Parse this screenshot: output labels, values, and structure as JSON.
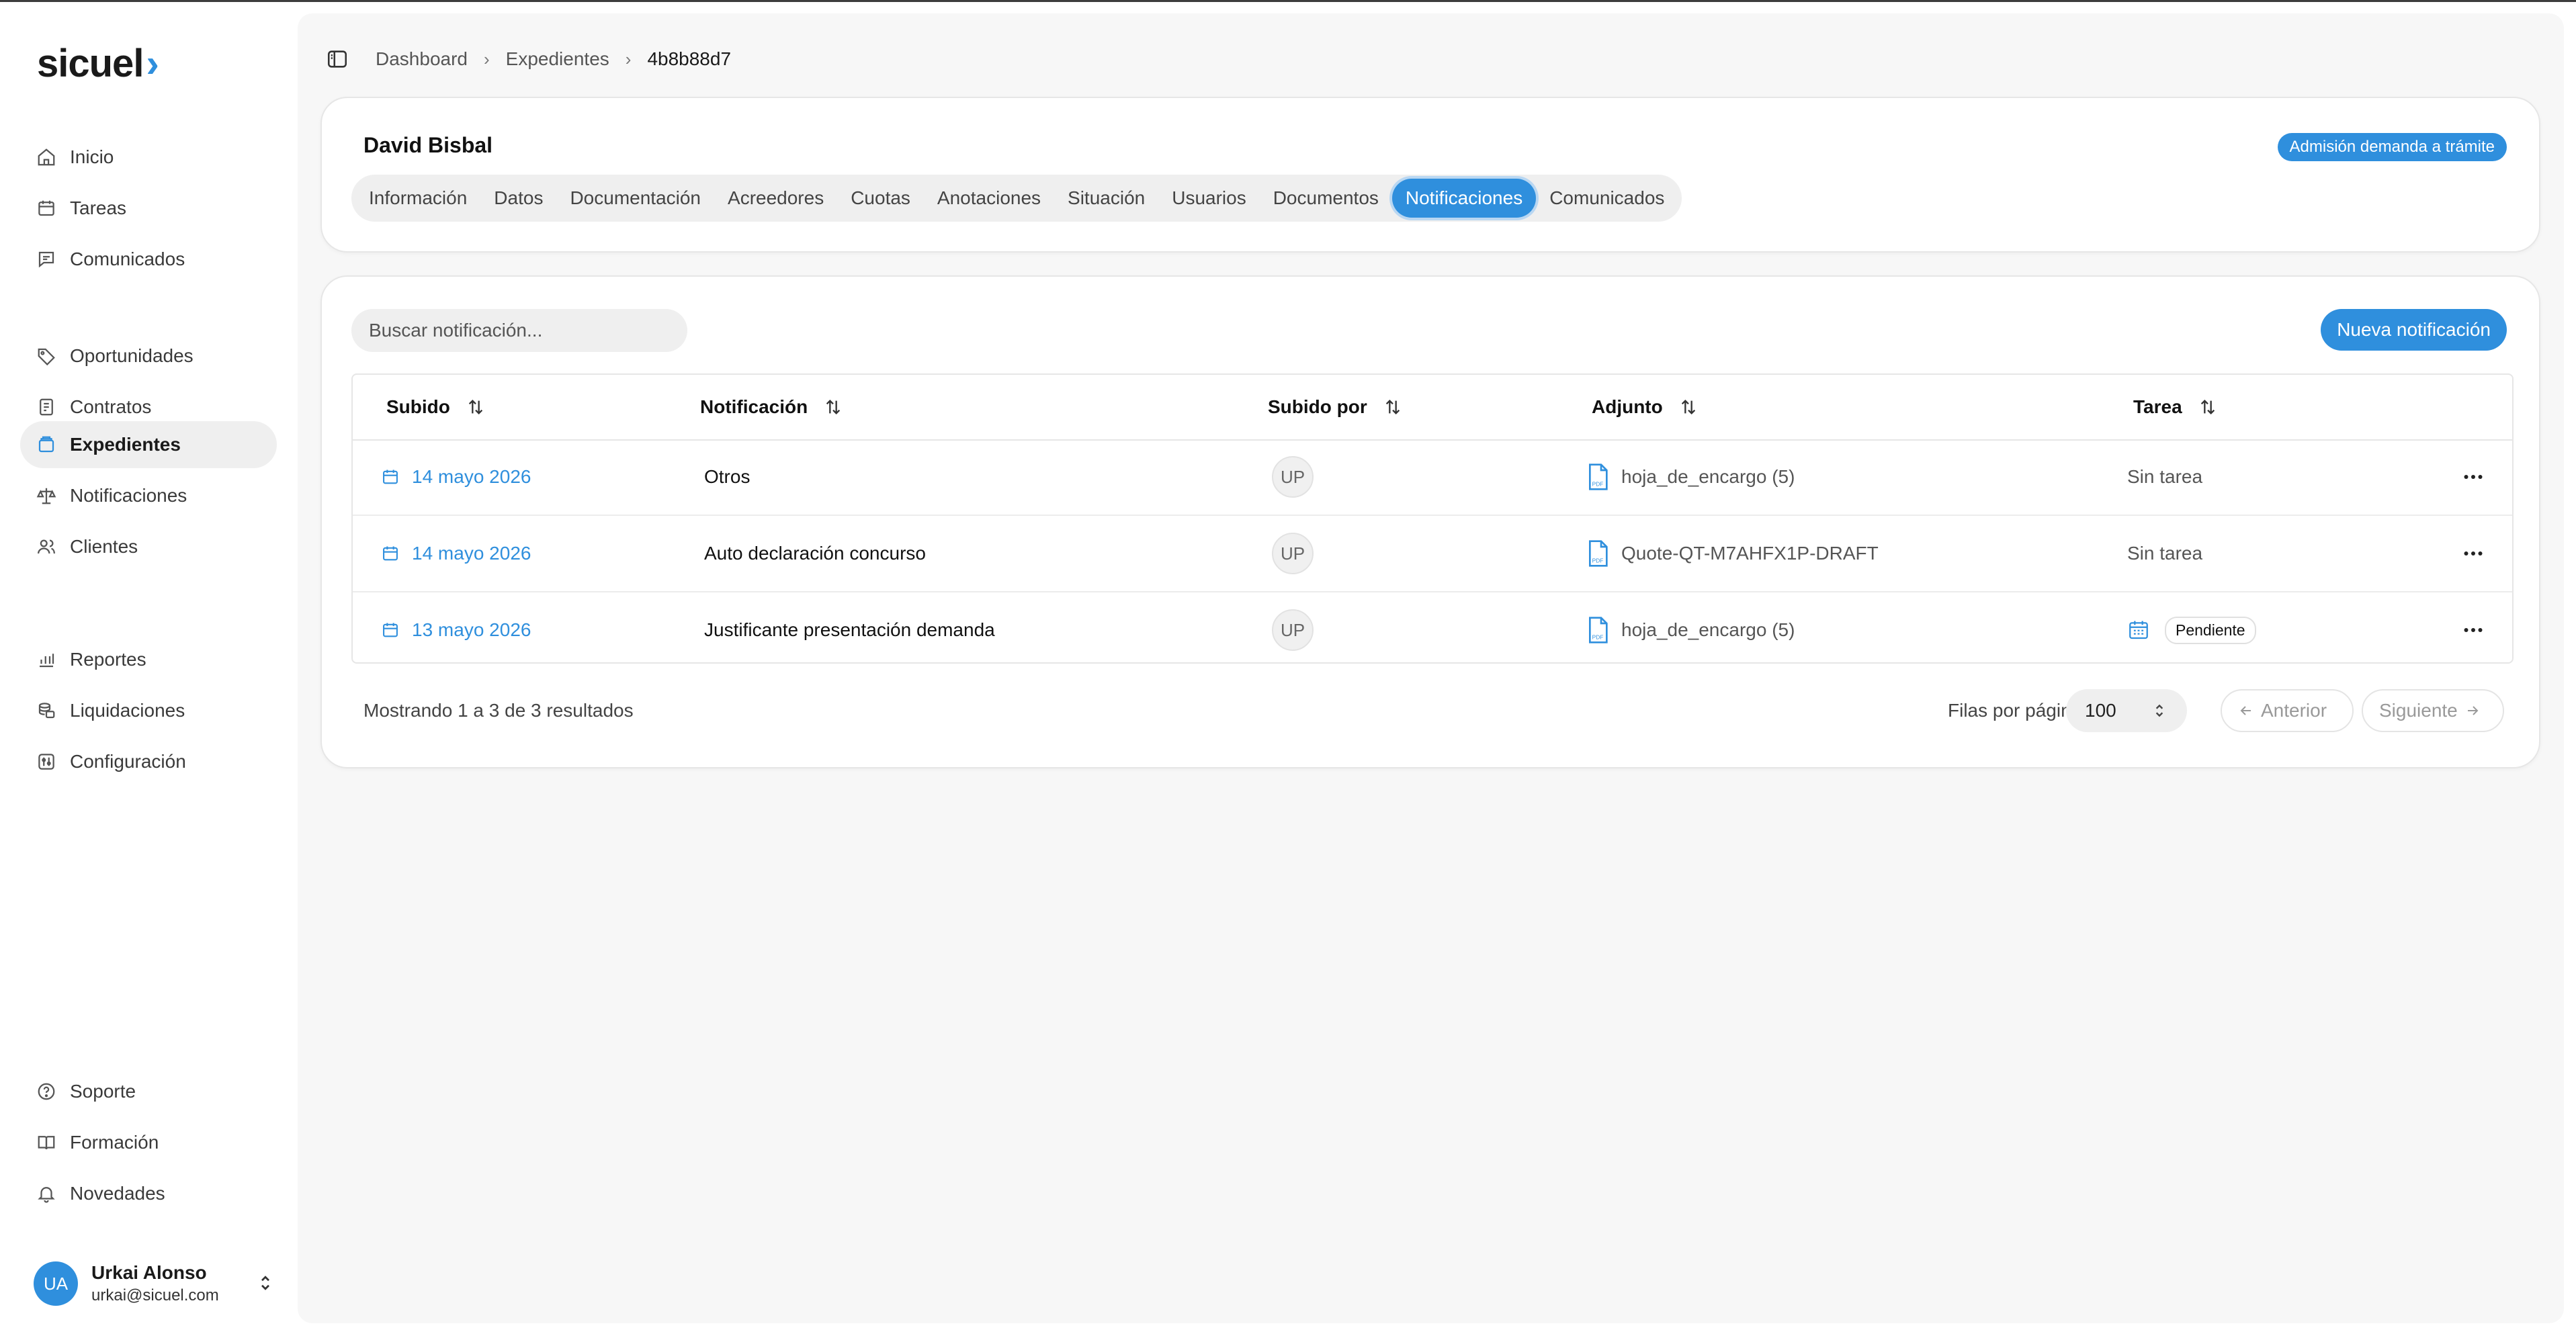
{
  "brand": {
    "name": "sicuel",
    "accent": "#2f8fdd"
  },
  "sidebar": {
    "items": [
      {
        "label": "Inicio",
        "icon": "home-icon"
      },
      {
        "label": "Tareas",
        "icon": "calendar-icon"
      },
      {
        "label": "Comunicados",
        "icon": "message-icon"
      },
      {
        "label": "Oportunidades",
        "icon": "tag-icon"
      },
      {
        "label": "Contratos",
        "icon": "contract-icon"
      },
      {
        "label": "Expedientes",
        "icon": "folder-stack-icon",
        "active": true
      },
      {
        "label": "Notificaciones",
        "icon": "scale-icon"
      },
      {
        "label": "Clientes",
        "icon": "users-icon"
      },
      {
        "label": "Reportes",
        "icon": "bar-chart-icon"
      },
      {
        "label": "Liquidaciones",
        "icon": "coins-icon"
      },
      {
        "label": "Configuración",
        "icon": "settings-icon"
      },
      {
        "label": "Soporte",
        "icon": "help-circle-icon"
      },
      {
        "label": "Formación",
        "icon": "book-icon"
      },
      {
        "label": "Novedades",
        "icon": "bell-icon"
      }
    ],
    "user": {
      "initials": "UA",
      "name": "Urkai Alonso",
      "email": "urkai@sicuel.com"
    }
  },
  "breadcrumb": {
    "items": [
      "Dashboard",
      "Expedientes"
    ],
    "current": "4b8b88d7"
  },
  "case": {
    "title": "David Bisbal",
    "status": "Admisión demanda a trámite",
    "tabs": [
      "Información",
      "Datos",
      "Documentación",
      "Acreedores",
      "Cuotas",
      "Anotaciones",
      "Situación",
      "Usuarios",
      "Documentos",
      "Notificaciones",
      "Comunicados"
    ],
    "active_tab": "Notificaciones"
  },
  "notifications": {
    "search_placeholder": "Buscar notificación...",
    "new_button": "Nueva notificación",
    "columns": [
      "Subido",
      "Notificación",
      "Subido por",
      "Adjunto",
      "Tarea"
    ],
    "rows": [
      {
        "date": "14 mayo 2026",
        "notification": "Otros",
        "uploader": "UP",
        "attachment": "hoja_de_encargo (5)",
        "task": "Sin tarea"
      },
      {
        "date": "14 mayo 2026",
        "notification": "Auto declaración concurso",
        "uploader": "UP",
        "attachment": "Quote-QT-M7AHFX1P-DRAFT",
        "task": "Sin tarea"
      },
      {
        "date": "13 mayo 2026",
        "notification": "Justificante presentación demanda",
        "uploader": "UP",
        "attachment": "hoja_de_encargo (5)",
        "task": "Pendiente"
      }
    ],
    "summary": "Mostrando 1 a 3 de 3 resultados",
    "rows_per_page_label": "Filas por página",
    "rows_per_page": "100",
    "prev": "Anterior",
    "next": "Siguiente"
  }
}
